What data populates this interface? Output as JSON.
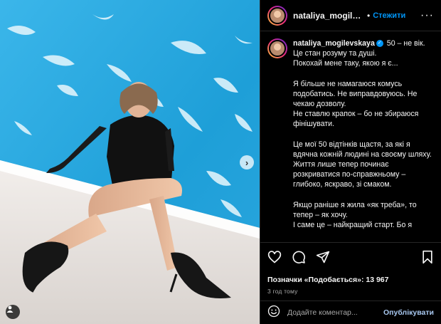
{
  "header": {
    "username": "nataliya_mogilevs...",
    "separator": "•",
    "follow_label": "Стежити",
    "more_label": "···"
  },
  "caption": {
    "username": "nataliya_mogilevskaya",
    "paragraphs": [
      "50 – не вік.\nЦе стан розуму та душі.\nПокохай мене таку, якою я є...",
      "Я більше не намагаюся комусь подобатись. Не виправдовуюсь. Не чекаю дозволу.\nНе ставлю крапок – бо не збираюся фінішувати.",
      "Це мої 50 відтінків щастя, за які я вдячна кожній людині на своєму шляху.\nЖиття лише тепер починає розкриватися по-справжньому – глибоко, яскраво, зі смаком.",
      "Якщо раніше я жила «як треба», то тепер – як хочу.\nІ саме це – найкращий старт. Бо я"
    ]
  },
  "stats": {
    "likes": "Позначки «Подобається»: 13 967",
    "time": "3 год тому"
  },
  "comment": {
    "placeholder": "Додайте коментар...",
    "publish_label": "Опублікувати"
  },
  "media": {
    "next_label": "›"
  },
  "colors": {
    "accent": "#0095f6",
    "pool": "#27a9e1",
    "background": "#000000"
  }
}
